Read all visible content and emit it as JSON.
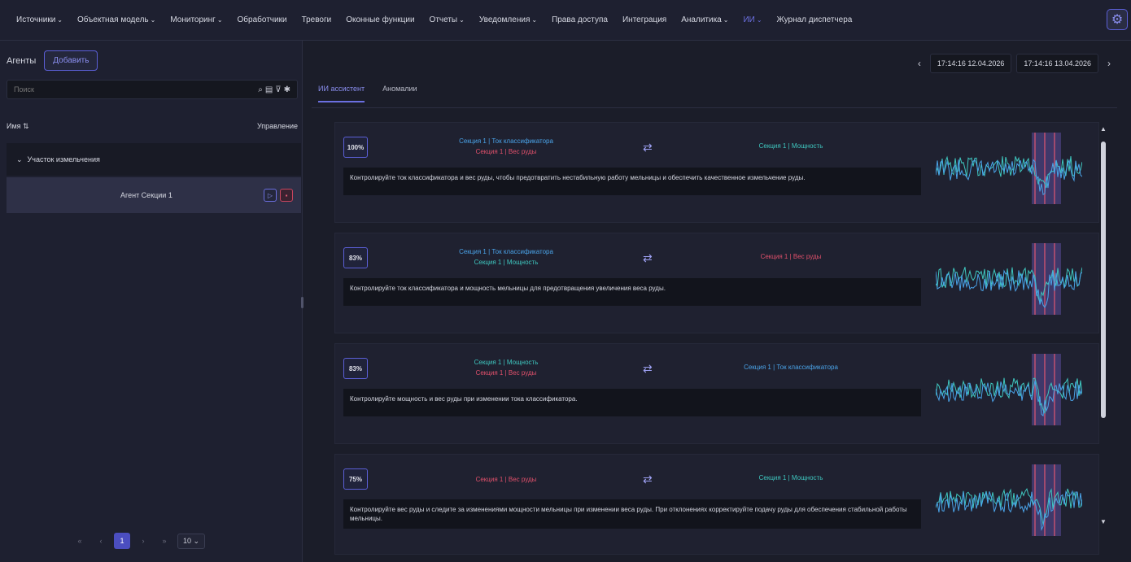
{
  "nav": {
    "items": [
      {
        "label": "Источники",
        "chevron": true
      },
      {
        "label": "Объектная модель",
        "chevron": true
      },
      {
        "label": "Мониторинг",
        "chevron": true
      },
      {
        "label": "Обработчики",
        "chevron": false
      },
      {
        "label": "Тревоги",
        "chevron": false
      },
      {
        "label": "Оконные функции",
        "chevron": false
      },
      {
        "label": "Отчеты",
        "chevron": true
      },
      {
        "label": "Уведомления",
        "chevron": true
      },
      {
        "label": "Права доступа",
        "chevron": false
      },
      {
        "label": "Интеграция",
        "chevron": false
      },
      {
        "label": "Аналитика",
        "chevron": true
      },
      {
        "label": "ИИ",
        "chevron": true,
        "active": true
      },
      {
        "label": "Журнал диспетчера",
        "chevron": false
      }
    ]
  },
  "sidebar": {
    "title": "Агенты",
    "add_label": "Добавить",
    "search_placeholder": "Поиск",
    "col_name": "Имя ⇅",
    "col_control": "Управление",
    "group_label": "Участок измельчения",
    "agent_name": "Агент Секции 1",
    "pagination": {
      "current": "1",
      "page_size": "10"
    }
  },
  "main": {
    "date_from": "17:14:16 12.04.2026",
    "date_to": "17:14:16 13.04.2026",
    "tabs": [
      {
        "label": "ИИ ассистент",
        "active": true
      },
      {
        "label": "Аномалии",
        "active": false
      }
    ],
    "cards": [
      {
        "pct": "100%",
        "src1": "Секция 1 | Ток классификатора",
        "src1_color": "blue",
        "src2": "Секция 1 | Вес руды",
        "src2_color": "red",
        "target": "Секция 1 | Мощность",
        "target_color": "teal",
        "desc": "Контролируйте ток классификатора и вес руды, чтобы предотвратить нестабильную работу мельницы и обеспечить качественное измельчение руды."
      },
      {
        "pct": "83%",
        "src1": "Секция 1 | Ток классификатора",
        "src1_color": "blue",
        "src2": "Секция 1 | Мощность",
        "src2_color": "teal",
        "target": "Секция 1 | Вес руды",
        "target_color": "red",
        "desc": "Контролируйте ток классификатора и мощность мельницы для предотвращения увеличения веса руды."
      },
      {
        "pct": "83%",
        "src1": "Секция 1 | Мощность",
        "src1_color": "teal",
        "src2": "Секция 1 | Вес руды",
        "src2_color": "red",
        "target": "Секция 1 | Ток классификатора",
        "target_color": "blue",
        "desc": "Контролируйте мощность и вес руды при изменении тока классификатора."
      },
      {
        "pct": "75%",
        "src1": "Секция 1 | Вес руды",
        "src1_color": "red",
        "src2": "",
        "src2_color": "red",
        "target": "Секция 1 | Мощность",
        "target_color": "teal",
        "desc": "Контролируйте вес руды и следите за изменениями мощности мельницы при изменении веса руды. При отклонениях корректируйте подачу руды для обеспечения стабильной работы мельницы."
      }
    ]
  },
  "colors": {
    "accent": "#6b6fe0",
    "blue": "#4aa3e8",
    "red": "#e0506b",
    "teal": "#3fc8c0"
  }
}
